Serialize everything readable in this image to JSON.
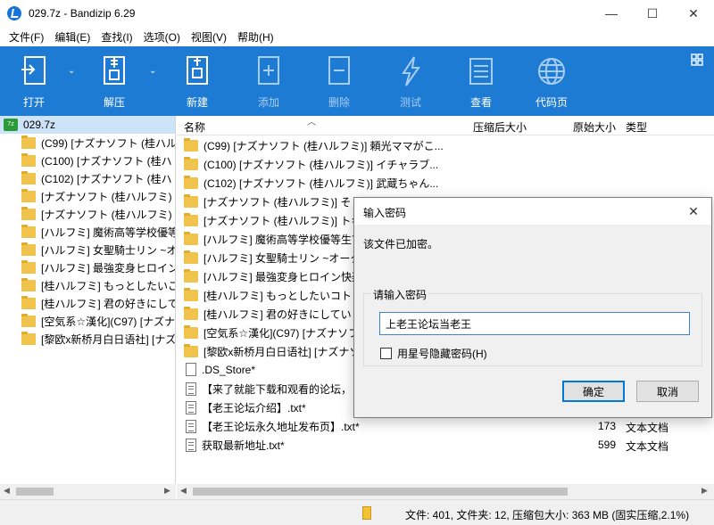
{
  "window": {
    "title": "029.7z - Bandizip 6.29",
    "min_glyph": "—",
    "max_glyph": "☐",
    "close_glyph": "✕"
  },
  "menu": [
    "文件(F)",
    "编辑(E)",
    "查找(I)",
    "选项(O)",
    "视图(V)",
    "帮助(H)"
  ],
  "toolbar": {
    "open": "打开",
    "extract": "解压",
    "new": "新建",
    "add": "添加",
    "delete": "删除",
    "test": "测试",
    "view": "查看",
    "codepage": "代码页"
  },
  "tree": {
    "root": "029.7z",
    "items": [
      "(C99) [ナズナソフト (桂ハル",
      "(C100) [ナズナソフト (桂ハ",
      "(C102) [ナズナソフト (桂ハ",
      "[ナズナソフト (桂ハルフミ)",
      "[ナズナソフト (桂ハルフミ)",
      "[ハルフミ] 魔術高等学校優等",
      "[ハルフミ] 女聖騎士リン ~オ",
      "[ハルフミ] 最強変身ヒロイン",
      "[桂ハルフミ] もっとしたいこ",
      "[桂ハルフミ] 君の好きにして",
      "[空気系☆漢化](C97) [ナズナ",
      "[黎欧x新桥月白日语社] [ナズ"
    ]
  },
  "list": {
    "columns": {
      "name": "名称",
      "compressed": "压缩后大小",
      "original": "原始大小",
      "type": "类型"
    },
    "rows": [
      {
        "icon": "folder",
        "name": "(C99) [ナズナソフト (桂ハルフミ)] 頼光ママがこ...",
        "original": "",
        "type": ""
      },
      {
        "icon": "folder",
        "name": "(C100) [ナズナソフト (桂ハルフミ)] イチャラブ...",
        "original": "",
        "type": ""
      },
      {
        "icon": "folder",
        "name": "(C102) [ナズナソフト (桂ハルフミ)] 武蔵ちゃん...",
        "original": "",
        "type": ""
      },
      {
        "icon": "folder",
        "name": "[ナズナソフト (桂ハルフミ)] そし",
        "original": "",
        "type": ""
      },
      {
        "icon": "folder",
        "name": "[ナズナソフト (桂ハルフミ)] トキ",
        "original": "",
        "type": ""
      },
      {
        "icon": "folder",
        "name": "[ハルフミ] 魔術高等学校優等生7",
        "original": "",
        "type": ""
      },
      {
        "icon": "folder",
        "name": "[ハルフミ] 女聖騎士リン ~オーク",
        "original": "",
        "type": ""
      },
      {
        "icon": "folder",
        "name": "[ハルフミ] 最強変身ヒロイン快楽",
        "original": "",
        "type": ""
      },
      {
        "icon": "folder",
        "name": "[桂ハルフミ] もっとしたいコト (",
        "original": "",
        "type": ""
      },
      {
        "icon": "folder",
        "name": "[桂ハルフミ] 君の好きにしてい",
        "original": "",
        "type": ""
      },
      {
        "icon": "folder",
        "name": "[空気系☆漢化](C97) [ナズナソフ",
        "original": "",
        "type": ""
      },
      {
        "icon": "folder",
        "name": "[黎欧x新桥月白日语社] [ナズナソ",
        "original": "",
        "type": ""
      },
      {
        "icon": "blank",
        "name": ".DS_Store*",
        "original": "",
        "type": ""
      },
      {
        "icon": "doc",
        "name": "【来了就能下载和观看的论坛，",
        "original": "",
        "type": ""
      },
      {
        "icon": "doc",
        "name": "【老王论坛介绍】.txt*",
        "original": "",
        "type": ""
      },
      {
        "icon": "doc",
        "name": "【老王论坛永久地址发布页】.txt*",
        "original": "173",
        "type": "文本文档"
      },
      {
        "icon": "doc",
        "name": "获取最新地址.txt*",
        "original": "599",
        "type": "文本文档"
      }
    ]
  },
  "status": {
    "text": "文件: 401, 文件夹: 12, 压缩包大小: 363 MB (固实压缩,2.1%)"
  },
  "dialog": {
    "title": "输入密码",
    "close_glyph": "✕",
    "message": "该文件已加密。",
    "group_label": "请输入密码",
    "password_value": "上老王论坛当老王",
    "checkbox_label": "用星号隐藏密码(H)",
    "ok": "确定",
    "cancel": "取消"
  }
}
